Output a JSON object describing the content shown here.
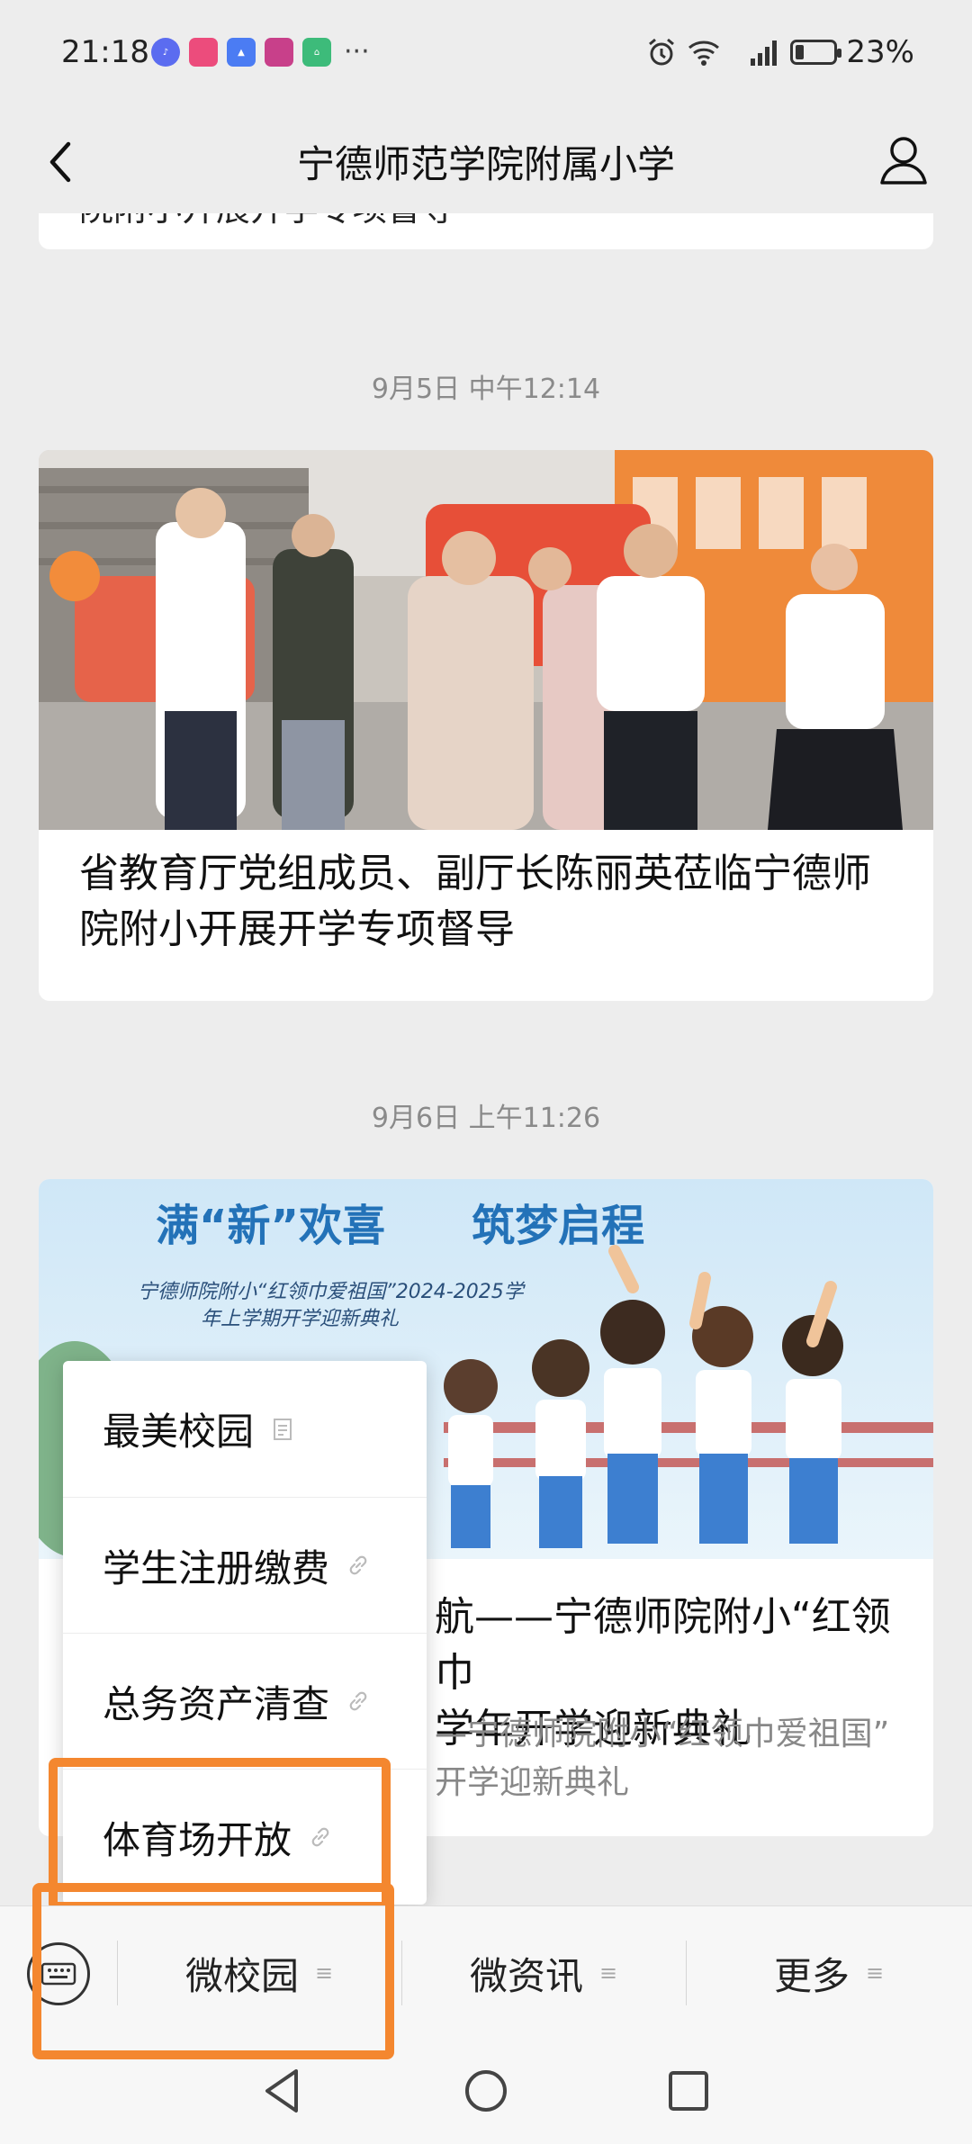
{
  "status_bar": {
    "time": "21:18",
    "battery_percent": "23%",
    "battery_level": 0.23
  },
  "nav": {
    "title": "宁德师范学院附属小学"
  },
  "feed": {
    "card_top": {
      "title_partial": "院附小开展开学专项督导"
    },
    "items": [
      {
        "time": "9月5日 中午12:14",
        "title": "省教育厅党组成员、副厅长陈丽英莅临宁德师院附小开展开学专项督导"
      },
      {
        "time": "9月6日 上午11:26",
        "banner_headline": "满“新”欢喜　　筑梦启程",
        "banner_sub1": "宁德师院附小“红领巾爱祖国”2024-2025学",
        "banner_sub2": "年上学期开学迎新典礼",
        "title_visible": "航——宁德师院附小“红领巾",
        "title_visible2": "学年开学迎新典礼",
        "digest_visible": "—宁德师院附小“红领巾爱祖国”",
        "digest_visible2": "开学迎新典礼"
      }
    ]
  },
  "dropdown": {
    "items": [
      {
        "label": "最美校园",
        "icon": "article-icon"
      },
      {
        "label": "学生注册缴费",
        "icon": "link-icon"
      },
      {
        "label": "总务资产清查",
        "icon": "link-icon"
      },
      {
        "label": "体育场开放",
        "icon": "link-icon"
      }
    ]
  },
  "tabbar": {
    "tabs": [
      {
        "label": "微校园"
      },
      {
        "label": "微资讯"
      },
      {
        "label": "更多"
      }
    ]
  },
  "colors": {
    "highlight": "#f4872f",
    "background": "#ededed"
  }
}
